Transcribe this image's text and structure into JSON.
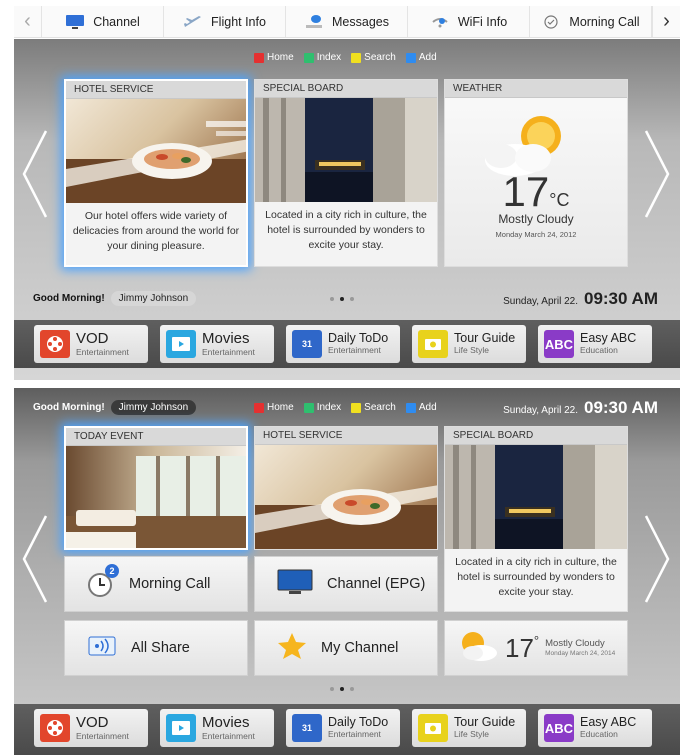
{
  "topnav": {
    "items": [
      {
        "label": "Channel",
        "icon": "tv-icon"
      },
      {
        "label": "Flight Info",
        "icon": "airplane-icon"
      },
      {
        "label": "Messages",
        "icon": "message-icon"
      },
      {
        "label": "WiFi Info",
        "icon": "wifi-icon"
      },
      {
        "label": "Morning Call",
        "icon": "clock-icon"
      }
    ]
  },
  "legend": {
    "home": "Home",
    "index": "Index",
    "search": "Search",
    "add": "Add",
    "colors": {
      "home": "#e53030",
      "index": "#2fbf6f",
      "search": "#f0e020",
      "add": "#2f8cf0"
    }
  },
  "screen1": {
    "cards": [
      {
        "header": "HOTEL SERVICE",
        "text": "Our hotel offers wide variety of delicacies from around the world for your dining pleasure."
      },
      {
        "header": "SPECIAL BOARD",
        "text": "Located in a city rich in culture, the hotel is surrounded by wonders to excite your stay."
      },
      {
        "header": "WEATHER",
        "temp": "17",
        "unit": "°C",
        "condition": "Mostly Cloudy",
        "date": "Monday March 24, 2012"
      }
    ],
    "greeting": "Good Morning!",
    "user": "Jimmy Johnson",
    "date": "Sunday, April 22.",
    "time": "09:30 AM"
  },
  "screen2": {
    "greeting": "Good Morning!",
    "user": "Jimmy Johnson",
    "date": "Sunday, April 22.",
    "time": "09:30 AM",
    "cards": [
      {
        "header": "TODAY EVENT"
      },
      {
        "header": "HOTEL SERVICE"
      },
      {
        "header": "SPECIAL BOARD",
        "text": "Located in a city rich in culture, the hotel is surrounded by wonders to excite your stay."
      }
    ],
    "tiles": {
      "morning_call": "Morning Call",
      "morning_call_badge": "2",
      "channel_epg": "Channel (EPG)",
      "all_share": "All Share",
      "my_channel": "My Channel"
    },
    "weather": {
      "temp": "17",
      "unit": "°",
      "condition": "Mostly Cloudy",
      "date": "Monday March 24, 2014"
    }
  },
  "dock": {
    "apps": [
      {
        "title": "VOD",
        "subtitle": "Entertainment",
        "icon": "film-reel-icon",
        "color": "#e2462c"
      },
      {
        "title": "Movies",
        "subtitle": "Entertainment",
        "icon": "movie-screen-icon",
        "color": "#2aa7e0"
      },
      {
        "title": "Daily ToDo",
        "subtitle": "Entertainment",
        "icon": "calendar-icon",
        "color": "#2f67c9",
        "icon_text": "31"
      },
      {
        "title": "Tour Guide",
        "subtitle": "Life Style",
        "icon": "camera-icon",
        "color": "#e8d21c"
      },
      {
        "title": "Easy ABC",
        "subtitle": "Education",
        "icon": "abc-icon",
        "color": "#8a3bc7",
        "icon_text": "ABC"
      }
    ]
  }
}
